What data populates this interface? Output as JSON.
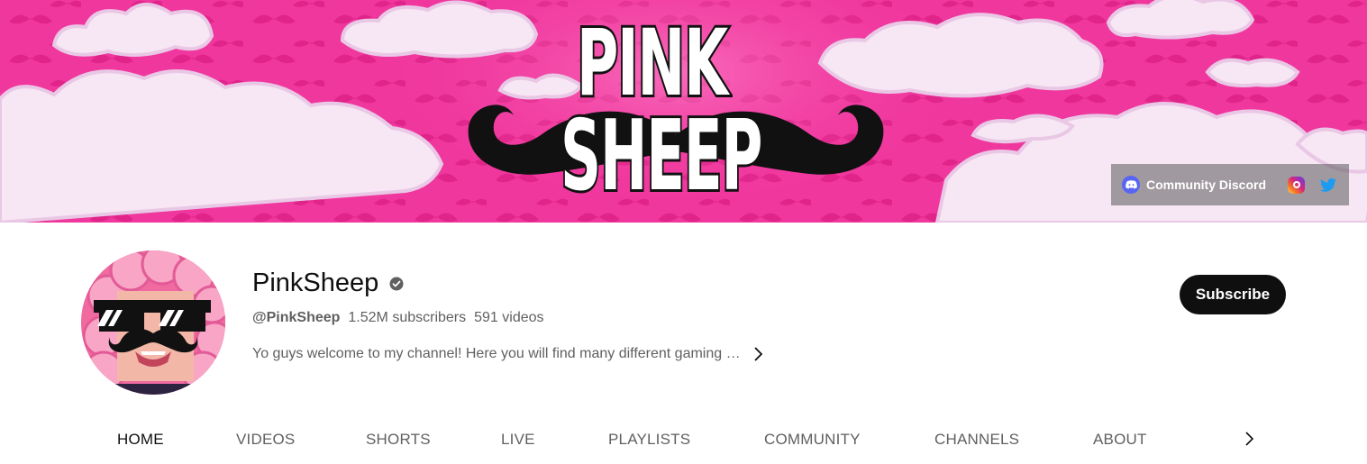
{
  "banner": {
    "logo_line1": "PINK",
    "logo_line2": "SHEEP",
    "links": {
      "discord_label": "Community Discord",
      "discord_icon": "discord-icon",
      "instagram_icon": "instagram-icon",
      "twitter_icon": "twitter-icon"
    }
  },
  "channel": {
    "name": "PinkSheep",
    "handle": "@PinkSheep",
    "subscribers": "1.52M subscribers",
    "videos": "591 videos",
    "description": "Yo guys welcome to my channel! Here you will find many different gaming …",
    "subscribe_label": "Subscribe"
  },
  "tabs": [
    "HOME",
    "VIDEOS",
    "SHORTS",
    "LIVE",
    "PLAYLISTS",
    "COMMUNITY",
    "CHANNELS",
    "ABOUT"
  ],
  "colors": {
    "banner_pink": "#f0379e",
    "cloud": "#f7e6f4",
    "subscribe_bg": "#0f0f0f",
    "discord": "#5865f2",
    "twitter": "#1d9bf0"
  }
}
